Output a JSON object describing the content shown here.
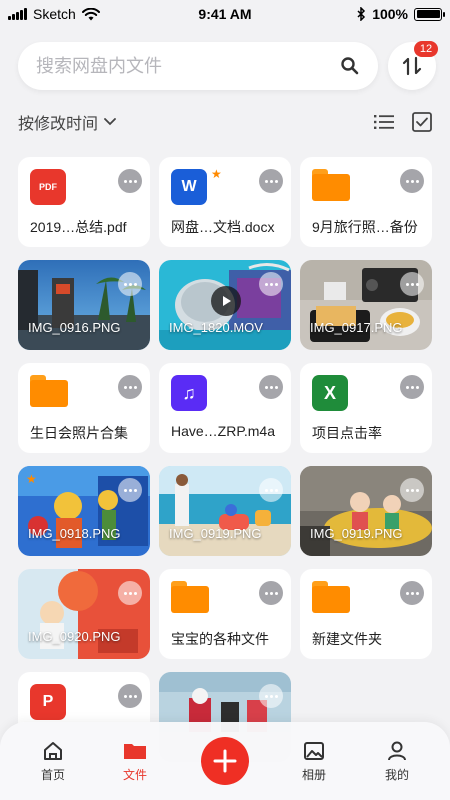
{
  "status_bar": {
    "carrier": "Sketch",
    "time": "9:41 AM",
    "battery": "100%",
    "battery_level": 1.0
  },
  "search": {
    "placeholder": "搜索网盘内文件"
  },
  "sort_badge": "12",
  "sort": {
    "label": "按修改时间"
  },
  "files": [
    {
      "name": "2019…总结.pdf",
      "type": "pdf",
      "icon_label": "PDF",
      "icon_color": "#e8372c"
    },
    {
      "name": "网盘…文档.docx",
      "type": "doc",
      "icon_label": "W",
      "icon_color": "#1a5ed8",
      "starred": true
    },
    {
      "name": "9月旅行照…备份",
      "type": "folder"
    },
    {
      "name": "IMG_0916.PNG",
      "type": "photo"
    },
    {
      "name": "IMG_1820.MOV",
      "type": "video"
    },
    {
      "name": "IMG_0917.PNG",
      "type": "photo"
    },
    {
      "name": "生日会照片合集",
      "type": "folder"
    },
    {
      "name": "Have…ZRP.m4a",
      "type": "audio",
      "icon_label": "♫",
      "icon_color": "#5a2cf5"
    },
    {
      "name": "项目点击率",
      "type": "xls",
      "icon_label": "X",
      "icon_color": "#1f8c3a"
    },
    {
      "name": "IMG_0918.PNG",
      "type": "photo",
      "starred": true
    },
    {
      "name": "IMG_0919.PNG",
      "type": "photo"
    },
    {
      "name": "IMG_0919.PNG",
      "type": "photo"
    },
    {
      "name": "IMG_0920.PNG",
      "type": "photo"
    },
    {
      "name": "宝宝的各种文件",
      "type": "folder"
    },
    {
      "name": "新建文件夹",
      "type": "folder"
    },
    {
      "name": "",
      "type": "ppt",
      "icon_label": "P",
      "icon_color": "#e8372c"
    },
    {
      "name": "",
      "type": "photo"
    }
  ],
  "nav": {
    "home": "首页",
    "files": "文件",
    "album": "相册",
    "mine": "我的"
  },
  "colors": {
    "accent": "#e8372c",
    "folder": "#ff8c00"
  }
}
